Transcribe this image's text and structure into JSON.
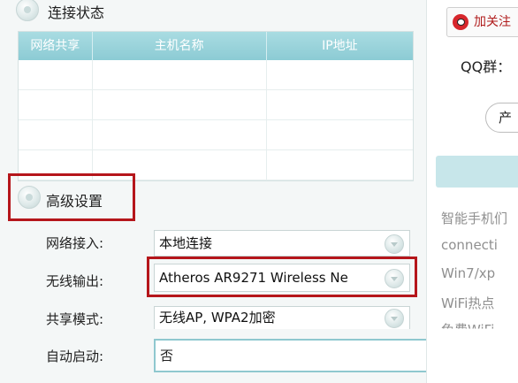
{
  "connection_status": {
    "title": "连接状态",
    "columns": [
      "网络共享",
      "主机名称",
      "IP地址"
    ],
    "rows": [
      [
        "",
        "",
        ""
      ],
      [
        "",
        "",
        ""
      ],
      [
        "",
        "",
        ""
      ],
      [
        "",
        "",
        ""
      ]
    ]
  },
  "advanced": {
    "title": "高级设置",
    "fields": [
      {
        "label": "网络接入:",
        "value": "本地连接"
      },
      {
        "label": "无线输出:",
        "value": "Atheros AR9271 Wireless Ne"
      },
      {
        "label": "共享模式:",
        "value": "无线AP, WPA2加密"
      },
      {
        "label": "自动启动:",
        "value": "否"
      }
    ]
  },
  "sidebar": {
    "weibo_label": "加关注",
    "qq_label": "QQ群：",
    "product_label": "产",
    "promo_lines": [
      "智能手机们",
      "connecti",
      "Win7/xp",
      "WiFi热点",
      "免费WiFi"
    ]
  },
  "colors": {
    "accent": "#8ccbd4",
    "highlight": "#b5161b"
  }
}
